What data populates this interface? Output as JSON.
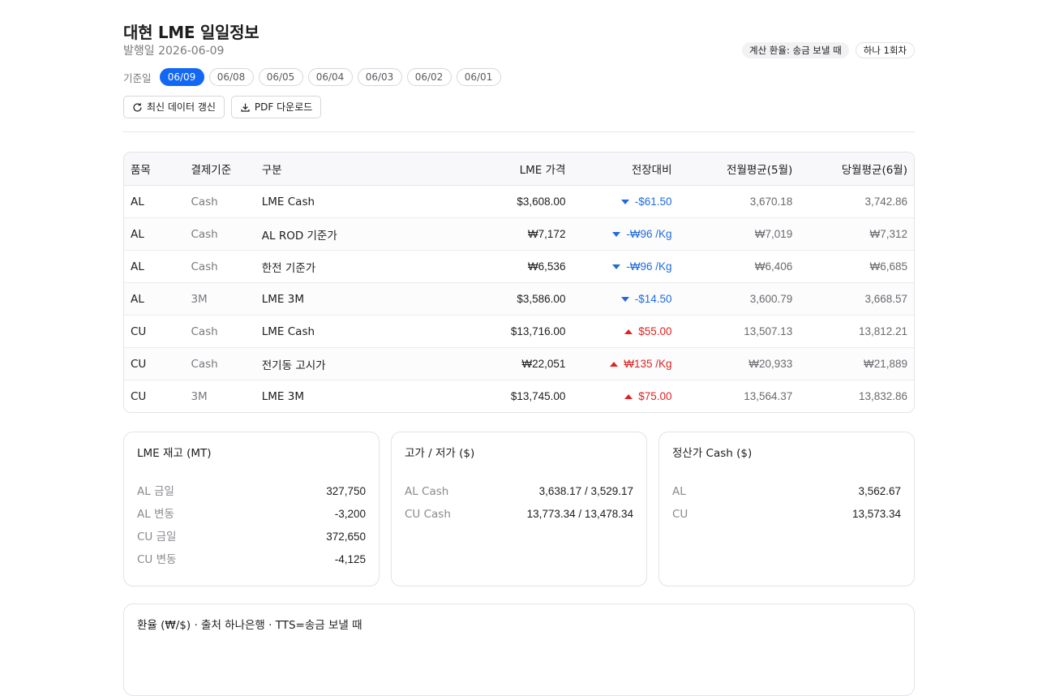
{
  "header": {
    "title": "대현 LME 일일정보",
    "issue_label": "발행일",
    "issue_date": "2026-06-09",
    "badges": [
      "계산 환율: 송금 보낼 때",
      "하나 1회차"
    ]
  },
  "dates": {
    "label": "기준일",
    "items": [
      "06/09",
      "06/08",
      "06/05",
      "06/04",
      "06/03",
      "06/02",
      "06/01"
    ],
    "selected": "06/09"
  },
  "actions": {
    "refresh_label": "최신 데이터 갱신",
    "pdf_label": "PDF 다운로드"
  },
  "table": {
    "headers": [
      "품목",
      "결제기준",
      "구분",
      "LME 가격",
      "전장대비",
      "전월평균(5월)",
      "당월평균(6월)"
    ],
    "rows": [
      {
        "item": "AL",
        "basis": "Cash",
        "type": "LME Cash",
        "price": "$3,608.00",
        "change": "-$61.50",
        "direction": "down",
        "prev_avg": "3,670.18",
        "cur_avg": "3,742.86"
      },
      {
        "item": "AL",
        "basis": "Cash",
        "type": "AL ROD 기준가",
        "price": "₩7,172",
        "change": "-₩96 /Kg",
        "direction": "down",
        "prev_avg": "₩7,019",
        "cur_avg": "₩7,312"
      },
      {
        "item": "AL",
        "basis": "Cash",
        "type": "한전 기준가",
        "price": "₩6,536",
        "change": "-₩96 /Kg",
        "direction": "down",
        "prev_avg": "₩6,406",
        "cur_avg": "₩6,685"
      },
      {
        "item": "AL",
        "basis": "3M",
        "type": "LME 3M",
        "price": "$3,586.00",
        "change": "-$14.50",
        "direction": "down",
        "prev_avg": "3,600.79",
        "cur_avg": "3,668.57"
      },
      {
        "item": "CU",
        "basis": "Cash",
        "type": "LME Cash",
        "price": "$13,716.00",
        "change": "$55.00",
        "direction": "up",
        "prev_avg": "13,507.13",
        "cur_avg": "13,812.21"
      },
      {
        "item": "CU",
        "basis": "Cash",
        "type": "전기동 고시가",
        "price": "₩22,051",
        "change": "₩135 /Kg",
        "direction": "up",
        "prev_avg": "₩20,933",
        "cur_avg": "₩21,889"
      },
      {
        "item": "CU",
        "basis": "3M",
        "type": "LME 3M",
        "price": "$13,745.00",
        "change": "$75.00",
        "direction": "up",
        "prev_avg": "13,564.37",
        "cur_avg": "13,832.86"
      }
    ]
  },
  "cards": [
    {
      "title": "LME 재고 (MT)",
      "rows": [
        {
          "k": "AL 금일",
          "v": "327,750"
        },
        {
          "k": "AL 변동",
          "v": "-3,200"
        },
        {
          "k": "CU 금일",
          "v": "372,650"
        },
        {
          "k": "CU 변동",
          "v": "-4,125"
        }
      ]
    },
    {
      "title": "고가 / 저가 ($)",
      "rows": [
        {
          "k": "AL Cash",
          "v": "3,638.17 / 3,529.17"
        },
        {
          "k": "CU Cash",
          "v": "13,773.34 / 13,478.34"
        }
      ]
    },
    {
      "title": "정산가 Cash ($)",
      "rows": [
        {
          "k": "AL",
          "v": "3,562.67"
        },
        {
          "k": "CU",
          "v": "13,573.34"
        }
      ]
    }
  ],
  "fx": {
    "title": "환율 (₩/$) · 출처 하나은행 · TTS=송금 보낼 때"
  },
  "colors": {
    "accent": "#1267f5",
    "down": "#1f6bdc",
    "up": "#de2323"
  }
}
